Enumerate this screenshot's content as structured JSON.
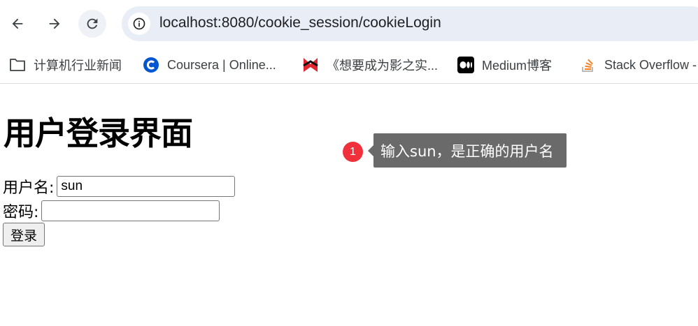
{
  "browser": {
    "url": "localhost:8080/cookie_session/cookieLogin",
    "icons": {
      "back": "arrow-left-icon",
      "forward": "arrow-right-icon",
      "reload": "reload-icon",
      "site_info": "info-icon"
    },
    "bookmarks": [
      {
        "label": "计算机行业新闻",
        "icon": "folder-icon"
      },
      {
        "label": "Coursera | Online...",
        "icon": "coursera-icon",
        "color": "#0056d2"
      },
      {
        "label": "《想要成为影之实...",
        "icon": "mangabz-icon",
        "color": "#e0262f"
      },
      {
        "label": "Medium博客",
        "icon": "medium-icon",
        "color": "#000000"
      },
      {
        "label": "Stack Overflow -",
        "icon": "stackoverflow-icon",
        "color": "#f48024"
      }
    ]
  },
  "page": {
    "title": "用户登录界面",
    "username_label": "用户名:",
    "username_value": "sun",
    "password_label": "密码:",
    "password_value": "",
    "submit_label": "登录"
  },
  "annotation": {
    "number": "1",
    "text": "输入sun，是正确的用户名",
    "marker_color": "#f0303a",
    "tooltip_color": "#6a6a6a"
  }
}
